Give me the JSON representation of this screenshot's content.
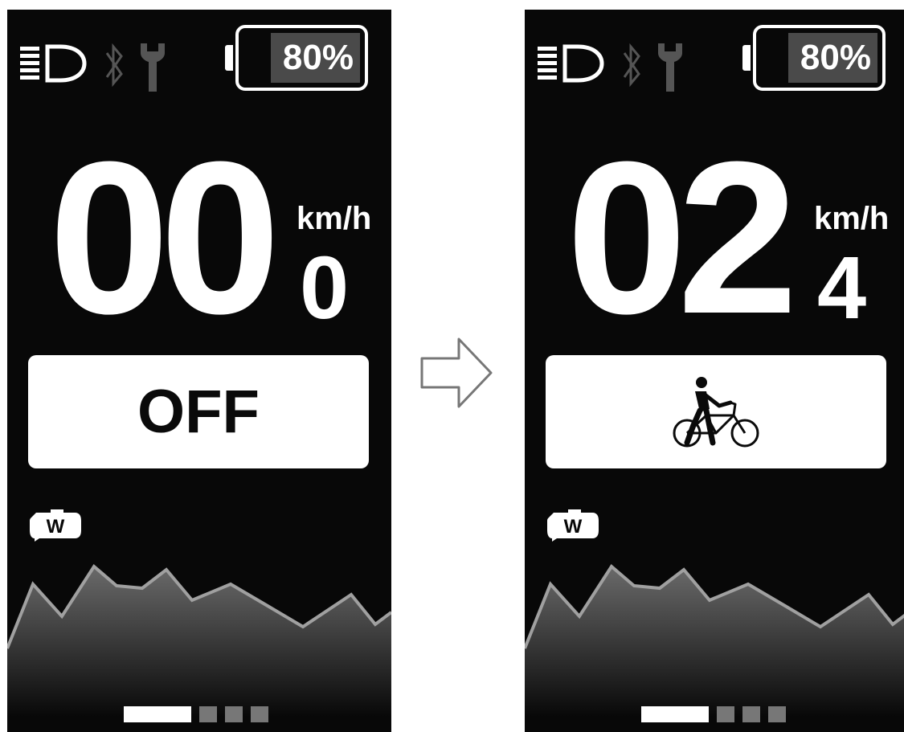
{
  "colors": {
    "screen_bg": "#080808",
    "foreground": "#ffffff",
    "inactive_icon": "#555555",
    "battery_fill": "#4a4a4a",
    "terrain_line": "#a0a0a0"
  },
  "status_icons": [
    "headlight-icon",
    "bluetooth-icon",
    "wrench-icon"
  ],
  "screens": [
    {
      "battery": {
        "percent": 80,
        "label": "80%"
      },
      "speed": {
        "integer": "00",
        "unit": "km/h",
        "decimal": "0"
      },
      "mode": {
        "label": "OFF",
        "icon": ""
      },
      "power_badge": "W",
      "pager": {
        "pages": 4,
        "active": 1
      }
    },
    {
      "battery": {
        "percent": 80,
        "label": "80%"
      },
      "speed": {
        "integer": "02",
        "unit": "km/h",
        "decimal": "4"
      },
      "mode": {
        "label": "",
        "icon": "walk-assist-icon"
      },
      "power_badge": "W",
      "pager": {
        "pages": 4,
        "active": 1
      }
    }
  ],
  "transition_icon": "right-arrow-icon"
}
